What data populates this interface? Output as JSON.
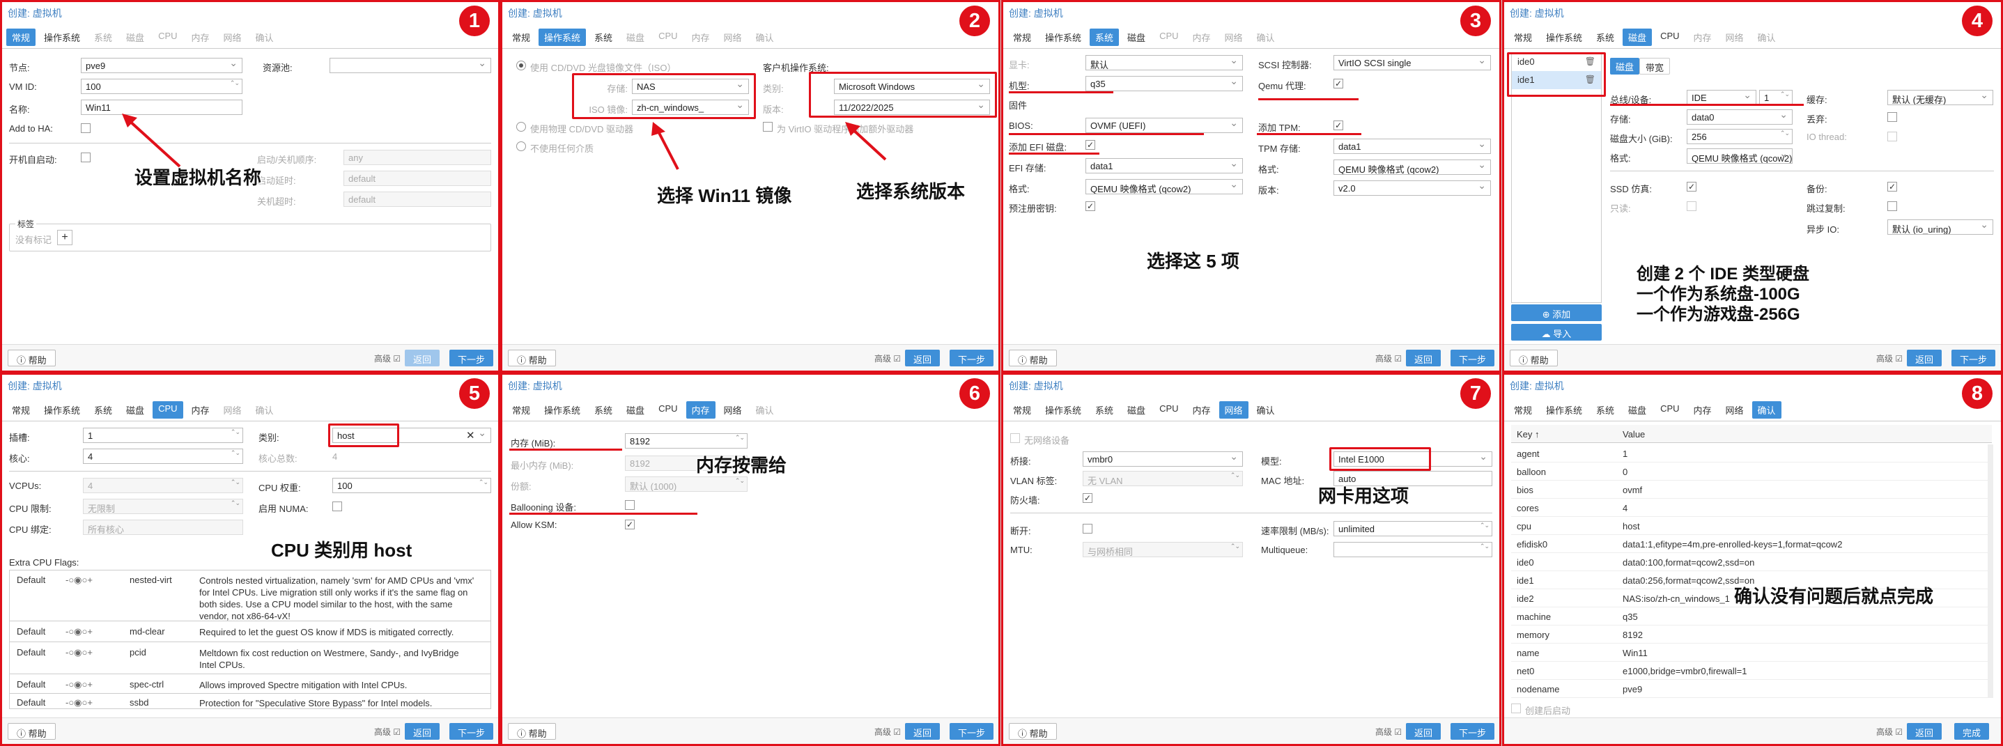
{
  "common": {
    "title": "创建: 虚拟机",
    "help": "帮助",
    "advanced": "高级",
    "back": "返回",
    "next": "下一步",
    "finish": "完成"
  },
  "tabs": [
    "常规",
    "操作系统",
    "系统",
    "磁盘",
    "CPU",
    "内存",
    "网络",
    "确认"
  ],
  "colors": {
    "accent": "#3e8fd8",
    "annotation_red": "#e0101a"
  },
  "p1": {
    "number": "1",
    "node_label": "节点:",
    "node_value": "pve9",
    "pool_label": "资源池:",
    "vmid_label": "VM ID:",
    "vmid_value": "100",
    "name_label": "名称:",
    "name_value": "Win11",
    "ha_label": "Add to HA:",
    "onboot_label": "开机自启动:",
    "order_label": "启动/关机顺序:",
    "order_value": "any",
    "startup_label": "启动延时:",
    "startup_value": "default",
    "shutdown_label": "关机超时:",
    "shutdown_value": "default",
    "tags_label": "标签",
    "tags_none": "没有标记",
    "annotation": "设置虚拟机名称"
  },
  "p2": {
    "number": "2",
    "iso_radio": "使用 CD/DVD 光盘镜像文件（ISO）",
    "storage_label": "存储:",
    "storage_value": "NAS",
    "iso_label": "ISO 镜像:",
    "iso_value": "zh-cn_windows_",
    "physical_radio": "使用物理 CD/DVD 驱动器",
    "none_radio": "不使用任何介质",
    "guest_label": "客户机操作系统:",
    "type_label": "类别:",
    "type_value": "Microsoft Windows",
    "version_label": "版本:",
    "version_value": "11/2022/2025",
    "virtio_label": "为 VirtIO 驱动程序添加额外驱动器",
    "annotation_iso": "选择 Win11 镜像",
    "annotation_ver": "选择系统版本"
  },
  "p3": {
    "number": "3",
    "display_label": "显卡:",
    "display_value": "默认",
    "machine_label": "机型:",
    "machine_value": "q35",
    "firmware_label": "固件",
    "bios_label": "BIOS:",
    "bios_value": "OVMF (UEFI)",
    "efi_label": "添加 EFI 磁盘:",
    "efistore_label": "EFI 存储:",
    "efistore_value": "data1",
    "format_label": "格式:",
    "format_value": "QEMU 映像格式 (qcow2)",
    "prekeys_label": "预注册密钥:",
    "scsi_label": "SCSI 控制器:",
    "scsi_value": "VirtIO SCSI single",
    "agent_label": "Qemu 代理:",
    "tpm_label": "添加 TPM:",
    "tpmstore_label": "TPM 存储:",
    "tpmstore_value": "data1",
    "tpmformat_label": "格式:",
    "tpmformat_value": "QEMU 映像格式 (qcow2)",
    "tpmver_label": "版本:",
    "tpmver_value": "v2.0",
    "annotation": "选择这 5 项"
  },
  "p4": {
    "number": "4",
    "disks": [
      "ide0",
      "ide1"
    ],
    "subtab_disk": "磁盘",
    "subtab_bw": "带宽",
    "bus_label": "总线/设备:",
    "bus_value": "IDE",
    "bus_index": "1",
    "storage_label": "存储:",
    "storage_value": "data0",
    "size_label": "磁盘大小 (GiB):",
    "size_value": "256",
    "format_label": "格式:",
    "format_value": "QEMU 映像格式 (qcow2)",
    "cache_label": "缓存:",
    "cache_value": "默认 (无缓存)",
    "discard_label": "丢弃:",
    "iothread_label": "IO thread:",
    "ssd_label": "SSD 仿真:",
    "readonly_label": "只读:",
    "backup_label": "备份:",
    "skiprepl_label": "跳过复制:",
    "async_label": "异步 IO:",
    "async_value": "默认 (io_uring)",
    "add_btn": "添加",
    "import_btn": "导入",
    "annotation": [
      "创建 2 个 IDE 类型硬盘",
      "一个作为系统盘-100G",
      "一个作为游戏盘-256G"
    ]
  },
  "p5": {
    "number": "5",
    "sockets_label": "插槽:",
    "sockets_value": "1",
    "cores_label": "核心:",
    "cores_value": "4",
    "type_label": "类别:",
    "type_value": "host",
    "total_label": "核心总数:",
    "total_value": "4",
    "vcpus_label": "VCPUs:",
    "vcpus_value": "4",
    "weight_label": "CPU 权重:",
    "weight_value": "100",
    "limit_label": "CPU 限制:",
    "limit_value": "无限制",
    "numa_label": "启用 NUMA:",
    "affinity_label": "CPU 绑定:",
    "affinity_value": "所有核心",
    "flags_label": "Extra CPU Flags:",
    "flags": [
      {
        "def": "Default",
        "name": "nested-virt",
        "desc": "Controls nested virtualization, namely 'svm' for AMD CPUs and 'vmx' for Intel CPUs. Live migration still only works if it's the same flag on both sides. Use a CPU model similar to the host, with the same vendor, not x86-64-vX!"
      },
      {
        "def": "Default",
        "name": "md-clear",
        "desc": "Required to let the guest OS know if MDS is mitigated correctly."
      },
      {
        "def": "Default",
        "name": "pcid",
        "desc": "Meltdown fix cost reduction on Westmere, Sandy-, and IvyBridge Intel CPUs."
      },
      {
        "def": "Default",
        "name": "spec-ctrl",
        "desc": "Allows improved Spectre mitigation with Intel CPUs."
      },
      {
        "def": "Default",
        "name": "ssbd",
        "desc": "Protection for \"Speculative Store Bypass\" for Intel models."
      }
    ],
    "annotation": "CPU 类别用 host"
  },
  "p6": {
    "number": "6",
    "mem_label": "内存 (MiB):",
    "mem_value": "8192",
    "minmem_label": "最小内存 (MiB):",
    "minmem_value": "8192",
    "shares_label": "份额:",
    "shares_value": "默认 (1000)",
    "balloon_label": "Ballooning 设备:",
    "ksm_label": "Allow KSM:",
    "annotation": "内存按需给"
  },
  "p7": {
    "number": "7",
    "nonet_label": "无网络设备",
    "bridge_label": "桥接:",
    "bridge_value": "vmbr0",
    "vlan_label": "VLAN 标签:",
    "vlan_value": "无 VLAN",
    "fw_label": "防火墙:",
    "model_label": "模型:",
    "model_value": "Intel E1000",
    "mac_label": "MAC 地址:",
    "mac_value": "auto",
    "disc_label": "断开:",
    "mtu_label": "MTU:",
    "mtu_value": "与网桥相同",
    "rate_label": "速率限制 (MB/s):",
    "rate_value": "unlimited",
    "mq_label": "Multiqueue:",
    "annotation": "网卡用这项"
  },
  "p8": {
    "number": "8",
    "key_header": "Key ↑",
    "value_header": "Value",
    "rows": [
      {
        "k": "agent",
        "v": "1"
      },
      {
        "k": "balloon",
        "v": "0"
      },
      {
        "k": "bios",
        "v": "ovmf"
      },
      {
        "k": "cores",
        "v": "4"
      },
      {
        "k": "cpu",
        "v": "host"
      },
      {
        "k": "efidisk0",
        "v": "data1:1,efitype=4m,pre-enrolled-keys=1,format=qcow2"
      },
      {
        "k": "ide0",
        "v": "data0:100,format=qcow2,ssd=on"
      },
      {
        "k": "ide1",
        "v": "data0:256,format=qcow2,ssd=on"
      },
      {
        "k": "ide2",
        "v": "NAS:iso/zh-cn_windows_1"
      },
      {
        "k": "machine",
        "v": "q35"
      },
      {
        "k": "memory",
        "v": "8192"
      },
      {
        "k": "name",
        "v": "Win11"
      },
      {
        "k": "net0",
        "v": "e1000,bridge=vmbr0,firewall=1"
      },
      {
        "k": "nodename",
        "v": "pve9"
      }
    ],
    "autostart_label": "创建后启动",
    "annotation": "确认没有问题后就点完成"
  }
}
